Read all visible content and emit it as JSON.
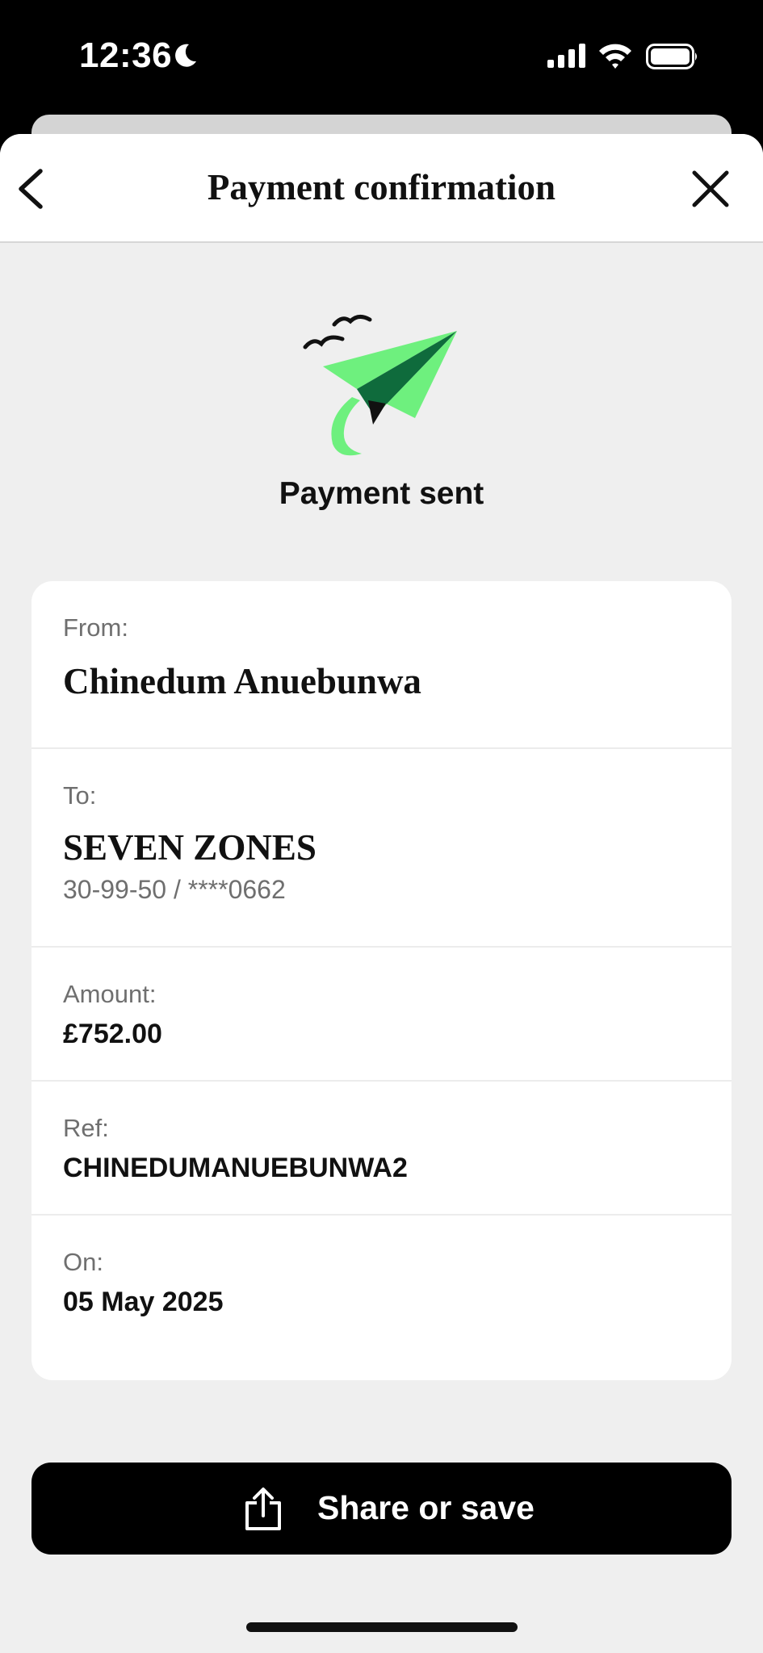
{
  "status_bar": {
    "time": "12:36",
    "icons": [
      "moon-icon",
      "signal-icon",
      "wifi-icon",
      "battery-icon"
    ]
  },
  "nav": {
    "title": "Payment confirmation",
    "back_icon": "chevron-left-icon",
    "close_icon": "close-icon"
  },
  "hero": {
    "icon": "paper-plane-icon",
    "title": "Payment sent"
  },
  "details": {
    "from_label": "From:",
    "from_value": "Chinedum Anuebunwa",
    "to_label": "To:",
    "to_value": "SEVEN ZONES",
    "to_account": "30-99-50 / ****0662",
    "amount_label": "Amount:",
    "amount_value": "£752.00",
    "ref_label": "Ref:",
    "ref_value": "CHINEDUMANUEBUNWA2",
    "on_label": "On:",
    "on_value": "05 May 2025"
  },
  "actions": {
    "share_label": "Share or save",
    "share_icon": "share-icon"
  },
  "colors": {
    "accent_green": "#6ef07e",
    "dark_green": "#0f6b3c",
    "background": "#efefef",
    "button": "#000000"
  }
}
